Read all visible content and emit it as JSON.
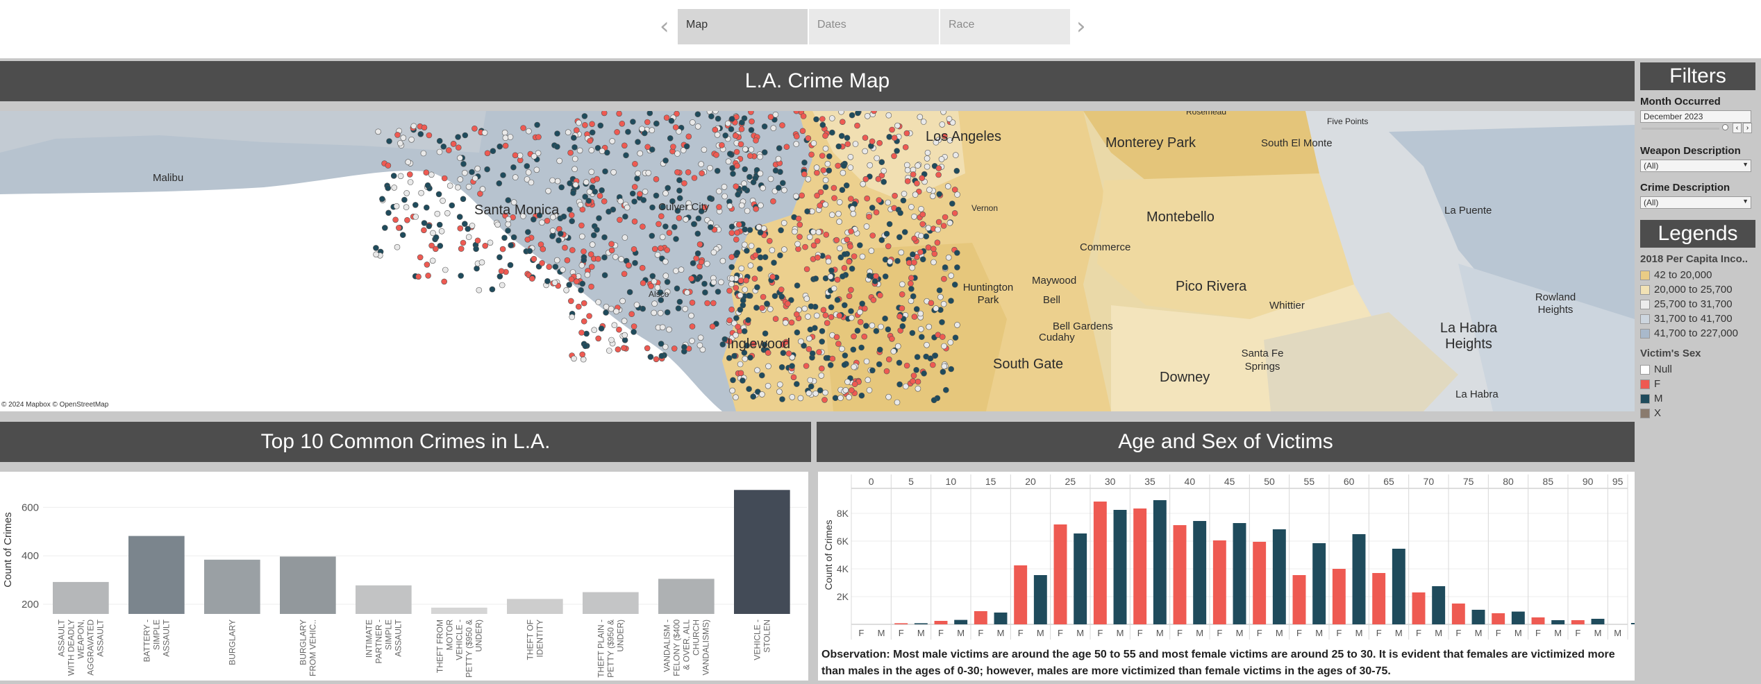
{
  "nav": {
    "tabs": [
      {
        "label": "Map",
        "active": true
      },
      {
        "label": "Dates",
        "active": false
      },
      {
        "label": "Race",
        "active": false
      }
    ],
    "prev_icon": "chevron-left-icon",
    "next_icon": "chevron-right-icon"
  },
  "map": {
    "title": "L.A. Crime Map",
    "attribution": "© 2024 Mapbox © OpenStreetMap",
    "places": [
      "Rosemead",
      "Five Points",
      "Malibu",
      "Los Angeles",
      "Monterey Park",
      "South El Monte",
      "Santa Monica",
      "Culver City",
      "Montebello",
      "La Puente",
      "Vernon",
      "Commerce",
      "Maywood",
      "Huntington Park",
      "Bell",
      "Pico Rivera",
      "Whittier",
      "Rowland Heights",
      "Alsco",
      "Bell Gardens",
      "Cudahy",
      "La Habra Heights",
      "Inglewood",
      "South Gate",
      "Santa Fe Springs",
      "Downey",
      "La Habra"
    ]
  },
  "filters": {
    "title": "Filters",
    "month_label": "Month Occurred",
    "month_value": "December 2023",
    "weapon_label": "Weapon Description",
    "weapon_value": "(All)",
    "crime_label": "Crime Description",
    "crime_value": "(All)"
  },
  "legends": {
    "title": "Legends",
    "income_title": "2018 Per Capita Inco..",
    "income_items": [
      {
        "label": "42 to 20,000",
        "color": "#e9cc85"
      },
      {
        "label": "20,000 to 25,700",
        "color": "#f2e2b5"
      },
      {
        "label": "25,700 to 31,700",
        "color": "#ececec"
      },
      {
        "label": "31,700 to 41,700",
        "color": "#cdd6df"
      },
      {
        "label": "41,700 to 227,000",
        "color": "#a9b9cb"
      }
    ],
    "sex_title": "Victim's Sex",
    "sex_items": [
      {
        "label": "Null",
        "color": "#ffffff"
      },
      {
        "label": "F",
        "color": "#ee5a52"
      },
      {
        "label": "M",
        "color": "#1f4b5c"
      },
      {
        "label": "X",
        "color": "#8a7b6e"
      }
    ]
  },
  "crimes_panel": {
    "title": "Top 10 Common Crimes in L.A."
  },
  "victims_panel": {
    "title": "Age and Sex of Victims"
  },
  "observation": "Observation: Most male victims are around the age 50 to 55 and most female victims are around 25 to 30. It is evident that females are victimized more than males in the ages of 0-30; however, males are more victimized than female victims in the ages of 30-75.",
  "chart_data": [
    {
      "type": "bar",
      "title": "Top 10 Common Crimes in L.A.",
      "ylabel": "Count of Crimes",
      "xlabel": "",
      "yticks": [
        200,
        400,
        600
      ],
      "ylim": [
        160,
        690
      ],
      "categories": [
        [
          "ASSAULT",
          "WITH DEADLY",
          "WEAPON,",
          "AGGRAVATED",
          "ASSAULT"
        ],
        [
          "BATTERY -",
          "SIMPLE",
          "ASSAULT"
        ],
        [
          "BURGLARY"
        ],
        [
          "BURGLARY",
          "FROM VEHIC.."
        ],
        [
          "INTIMATE",
          "PARTNER -",
          "SIMPLE",
          "ASSAULT"
        ],
        [
          "THEFT FROM",
          "MOTOR",
          "VEHICLE -",
          "PETTY ($950 &",
          "UNDER)"
        ],
        [
          "THEFT OF",
          "IDENTITY"
        ],
        [
          "THEFT PLAIN -",
          "PETTY ($950 &",
          "UNDER)"
        ],
        [
          "VANDALISM -",
          "FELONY ($400",
          "& OVER, ALL",
          "CHURCH",
          "VANDALISMS)"
        ],
        [
          "VEHICLE -",
          "STOLEN"
        ]
      ],
      "values": [
        292,
        482,
        384,
        397,
        278,
        186,
        222,
        250,
        305,
        672
      ],
      "colors": [
        "#b5b7b9",
        "#7b858d",
        "#9aa0a4",
        "#92989c",
        "#c2c3c4",
        "#d5d5d5",
        "#cdcdcd",
        "#c4c5c6",
        "#aeb1b3",
        "#434b57"
      ]
    },
    {
      "type": "bar",
      "title": "Age and Sex of Victims",
      "ylabel": "Count of Crimes",
      "yticks": [
        "2K",
        "4K",
        "6K",
        "8K"
      ],
      "ylim": [
        0,
        9500
      ],
      "age_groups": [
        "0",
        "5",
        "10",
        "15",
        "20",
        "25",
        "30",
        "35",
        "40",
        "45",
        "50",
        "55",
        "60",
        "65",
        "70",
        "75",
        "80",
        "85",
        "90",
        "95"
      ],
      "sexes": [
        "F",
        "M"
      ],
      "series": [
        {
          "name": "F",
          "color": "#ee5a52",
          "values": [
            0,
            80,
            250,
            950,
            4250,
            7200,
            8850,
            8350,
            7150,
            6050,
            5950,
            3550,
            4000,
            3700,
            2300,
            1500,
            800,
            500,
            300,
            0
          ]
        },
        {
          "name": "M",
          "color": "#1f4b5c",
          "values": [
            0,
            80,
            320,
            850,
            3550,
            6550,
            8250,
            8950,
            7450,
            7300,
            6850,
            5850,
            6500,
            5450,
            2750,
            1050,
            920,
            300,
            400,
            100
          ]
        }
      ]
    }
  ]
}
